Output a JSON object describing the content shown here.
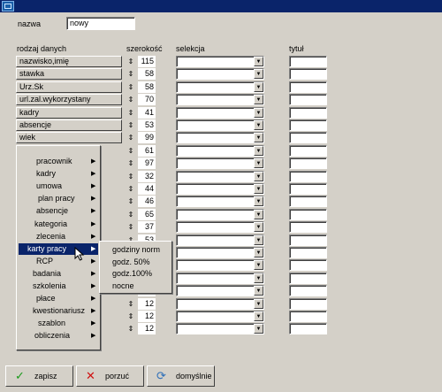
{
  "titlebar": {
    "icon": "app-window-icon"
  },
  "form": {
    "name_label": "nazwa",
    "name_value": "nowy",
    "col_rodzaj": "rodzaj danych",
    "col_szerokosc": "szerokość",
    "col_selekcja": "selekcja",
    "col_tytul": "tytuł"
  },
  "rows": [
    {
      "label": "nazwisko,imię",
      "width": "115"
    },
    {
      "label": "stawka",
      "width": "58"
    },
    {
      "label": "Urz.Sk",
      "width": "58"
    },
    {
      "label": "url.zal.wykorzystany",
      "width": "70"
    },
    {
      "label": "kadry",
      "width": "41"
    },
    {
      "label": "absencje",
      "width": "53"
    },
    {
      "label": "wiek",
      "width": "99"
    },
    {
      "label": "",
      "width": "61"
    },
    {
      "label": "",
      "width": "97"
    },
    {
      "label": "",
      "width": "32"
    },
    {
      "label": "",
      "width": "44"
    },
    {
      "label": "",
      "width": "46"
    },
    {
      "label": "",
      "width": "65"
    },
    {
      "label": "",
      "width": "37"
    },
    {
      "label": "",
      "width": "53"
    },
    {
      "label": "",
      "width": ""
    },
    {
      "label": "",
      "width": ""
    },
    {
      "label": "",
      "width": ""
    },
    {
      "label": "",
      "width": ""
    },
    {
      "label": "",
      "width": "12"
    },
    {
      "label": "",
      "width": "12"
    },
    {
      "label": "",
      "width": "12"
    }
  ],
  "context_menu": {
    "items": [
      {
        "label": "pracownik",
        "submenu": true
      },
      {
        "label": "kadry",
        "submenu": true
      },
      {
        "label": "umowa",
        "submenu": true
      },
      {
        "label": "plan pracy",
        "submenu": true
      },
      {
        "label": "absencje",
        "submenu": true
      },
      {
        "label": "kategoria",
        "submenu": true
      },
      {
        "label": "zlecenia",
        "submenu": true
      },
      {
        "label": "karty pracy",
        "submenu": true,
        "highlighted": true
      },
      {
        "label": "RCP",
        "submenu": true
      },
      {
        "label": "badania",
        "submenu": true
      },
      {
        "label": "szkolenia",
        "submenu": true
      },
      {
        "label": "płace",
        "submenu": true
      },
      {
        "label": "kwestionariusz",
        "submenu": true
      },
      {
        "label": "szablon",
        "submenu": true
      },
      {
        "label": "obliczenia",
        "submenu": true
      }
    ]
  },
  "submenu": {
    "items": [
      "godziny norm",
      "godz. 50%",
      "godz.100%",
      "nocne"
    ]
  },
  "buttons": {
    "save": "zapisz",
    "discard": "porzuć",
    "defaults": "domyślnie"
  },
  "colors": {
    "title_bar": "#0a246a",
    "face": "#d4d0c8",
    "highlight": "#0a246a"
  }
}
